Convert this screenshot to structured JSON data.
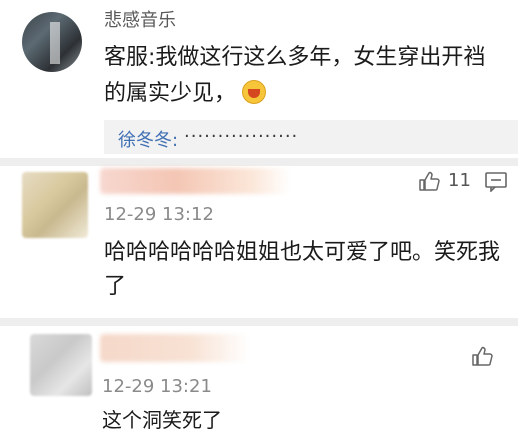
{
  "top_comment": {
    "username": "悲感音乐",
    "text": "客服:我做这行这么多年，女生穿出开裆的属实少见，",
    "emoji": "laughing-emoji",
    "reply": {
      "user": "徐冬冬:",
      "text": "·················"
    }
  },
  "comment_2": {
    "time": "12-29 13:12",
    "likes": "11",
    "text": "哈哈哈哈哈哈姐姐也太可爱了吧。笑死我了",
    "icons": [
      "thumbs-up-icon",
      "comment-icon"
    ]
  },
  "comment_3": {
    "time": "12-29 13:21",
    "text": "这个洞笑死了",
    "icons": [
      "thumbs-up-icon"
    ]
  },
  "colors": {
    "link_blue": "#3f6fb3",
    "separator": "#eeeeee",
    "reply_bg": "#f2f2f2"
  }
}
